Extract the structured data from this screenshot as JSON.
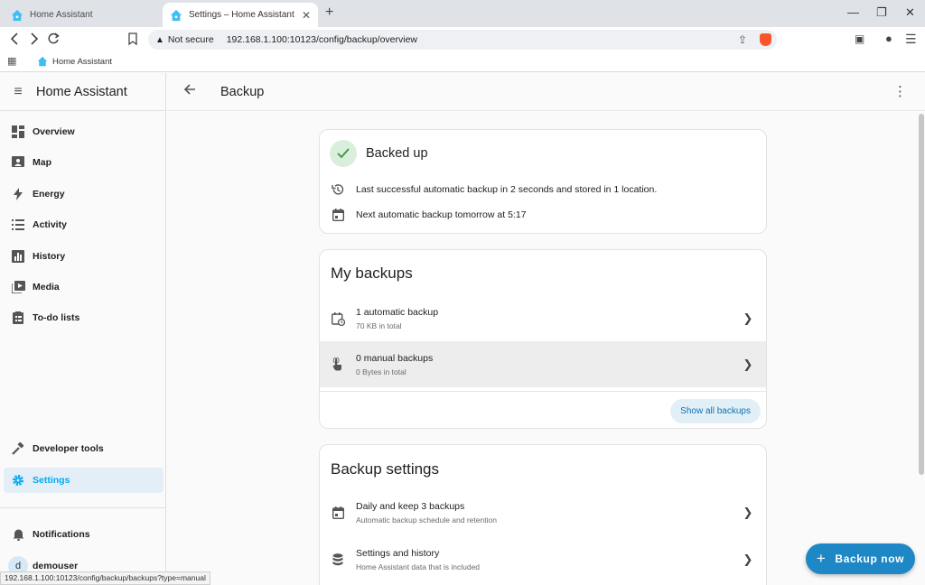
{
  "browser": {
    "tabs": [
      {
        "title": "Home Assistant",
        "active": false
      },
      {
        "title": "Settings – Home Assistant",
        "active": true
      }
    ],
    "address": {
      "security_label": "Not secure",
      "url": "192.168.1.100:10123/config/backup/overview"
    },
    "bookmark": "Home Assistant",
    "status_url": "192.168.1.100:10123/config/backup/backups?type=manual"
  },
  "sidebar": {
    "title": "Home Assistant",
    "items": [
      {
        "label": "Overview",
        "icon": "dashboard-icon"
      },
      {
        "label": "Map",
        "icon": "map-icon"
      },
      {
        "label": "Energy",
        "icon": "lightning-icon"
      },
      {
        "label": "Activity",
        "icon": "list-icon"
      },
      {
        "label": "History",
        "icon": "chart-icon"
      },
      {
        "label": "Media",
        "icon": "media-icon"
      },
      {
        "label": "To-do lists",
        "icon": "clipboard-icon"
      }
    ],
    "developer_tools": "Developer tools",
    "settings": "Settings",
    "notifications": "Notifications",
    "user": {
      "name": "demouser",
      "initial": "d"
    }
  },
  "header": {
    "title": "Backup"
  },
  "status_card": {
    "title": "Backed up",
    "last_backup": "Last successful automatic backup in 2 seconds and stored in 1 location.",
    "next_backup": "Next automatic backup tomorrow at 5:17"
  },
  "my_backups": {
    "title": "My backups",
    "rows": [
      {
        "primary": "1 automatic backup",
        "secondary": "70 KB in total"
      },
      {
        "primary": "0 manual backups",
        "secondary": "0 Bytes in total"
      }
    ],
    "show_all": "Show all backups"
  },
  "backup_settings": {
    "title": "Backup settings",
    "rows": [
      {
        "primary": "Daily and keep 3 backups",
        "secondary": "Automatic backup schedule and retention"
      },
      {
        "primary": "Settings and history",
        "secondary": "Home Assistant data that is included"
      }
    ]
  },
  "fab": {
    "label": "Backup now"
  },
  "colors": {
    "accent": "#03a9f4",
    "fab": "#1e88c6",
    "success": "#d9efdb"
  }
}
